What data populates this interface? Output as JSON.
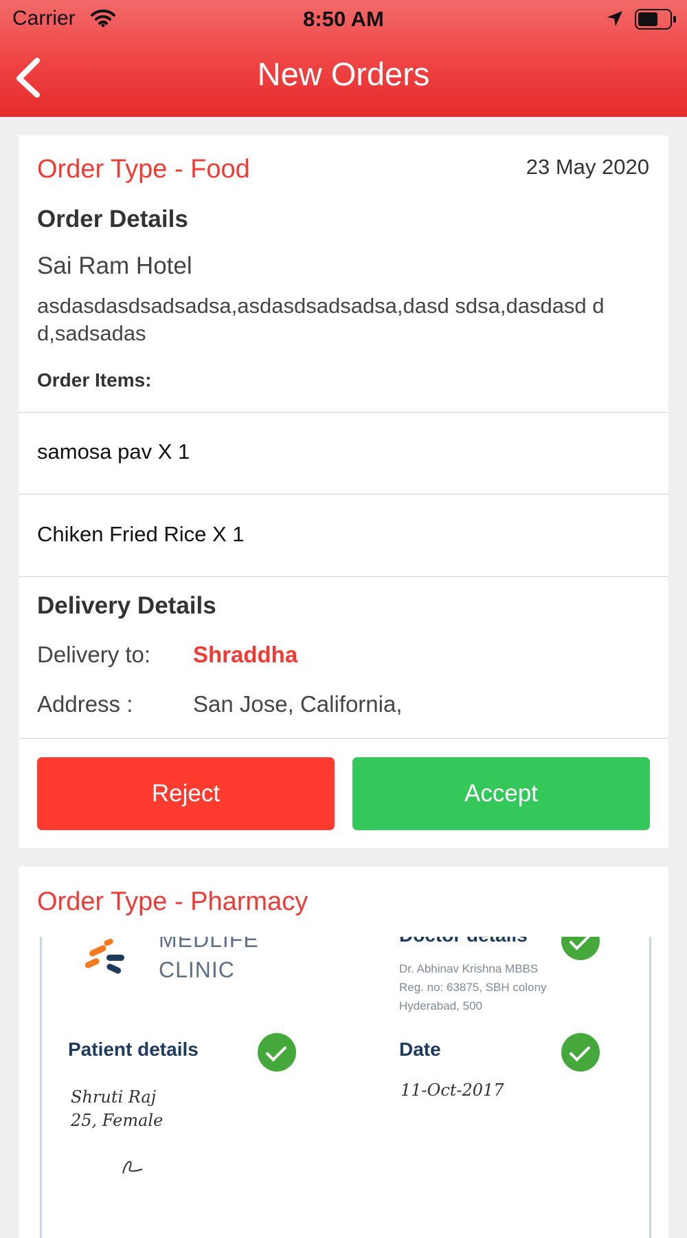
{
  "status_bar": {
    "carrier": "Carrier",
    "time": "8:50 AM"
  },
  "header": {
    "title": "New Orders",
    "back_icon": "chevron-left-icon",
    "background": "#ef4343"
  },
  "orders": [
    {
      "order_type": "Order Type - Food",
      "date": "23 May 2020",
      "details_heading": "Order Details",
      "restaurant": "Sai Ram Hotel",
      "address": "asdasdasdsadsadsa,asdasdsadsadsa,dasd sdsa,dasdasd d d,sadsadas",
      "items_label": "Order Items:",
      "items": [
        "samosa pav X 1",
        "Chiken Fried Rice X 1"
      ],
      "delivery_heading": "Delivery Details",
      "delivery_to_label": "Delivery to:",
      "delivery_to": "Shraddha",
      "address_label": "Address :",
      "delivery_address": "San Jose, California,",
      "reject_label": "Reject",
      "accept_label": "Accept",
      "reject_color": "#ff3b30",
      "accept_color": "#34c759"
    },
    {
      "order_type": "Order Type - Pharmacy",
      "prescription": {
        "clinic_line1": "MEDLIFE",
        "clinic_line2": "CLINIC",
        "doctor_heading": "Doctor details",
        "doctor_lines": [
          "Dr. Abhinav Krishna MBBS",
          "Reg. no: 63875, SBH colony",
          "Hyderabad, 500"
        ],
        "patient_heading": "Patient details",
        "patient_lines": [
          "Shruti Raj",
          "25, Female"
        ],
        "date_heading": "Date",
        "date_value": "11-Oct-2017"
      }
    }
  ],
  "accent_color": "#ef3b33"
}
